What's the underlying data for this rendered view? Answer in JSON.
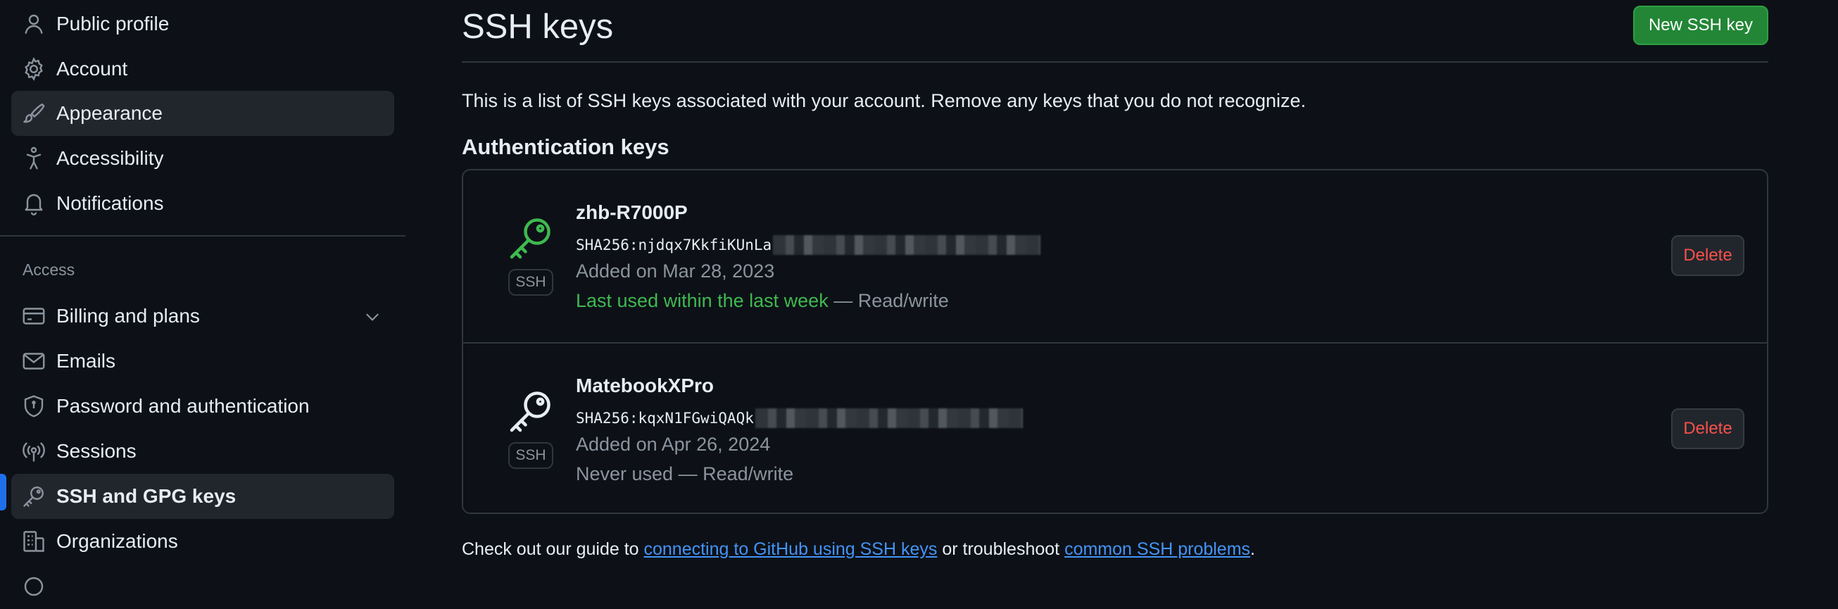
{
  "sidebar": {
    "items_top": [
      {
        "label": "Public profile",
        "icon": "person-icon"
      },
      {
        "label": "Account",
        "icon": "gear-icon"
      },
      {
        "label": "Appearance",
        "icon": "paintbrush-icon"
      },
      {
        "label": "Accessibility",
        "icon": "accessibility-icon"
      },
      {
        "label": "Notifications",
        "icon": "bell-icon"
      }
    ],
    "section_label": "Access",
    "items_access": [
      {
        "label": "Billing and plans",
        "icon": "credit-card-icon"
      },
      {
        "label": "Emails",
        "icon": "mail-icon"
      },
      {
        "label": "Password and authentication",
        "icon": "shield-lock-icon"
      },
      {
        "label": "Sessions",
        "icon": "broadcast-icon"
      },
      {
        "label": "SSH and GPG keys",
        "icon": "key-icon"
      },
      {
        "label": "Organizations",
        "icon": "organization-icon"
      }
    ],
    "active": "SSH and GPG keys",
    "accent": "#1f6feb"
  },
  "main": {
    "title": "SSH keys",
    "new_key_button": "New SSH key",
    "intro": "This is a list of SSH keys associated with your account. Remove any keys that you do not recognize.",
    "section_title": "Authentication keys",
    "keys": [
      {
        "name": "zhb-R7000P",
        "fingerprint": "SHA256:njdqx7KkfiKUnLa",
        "added": "Added on Mar 28, 2023",
        "last_used": "Last used within the last week",
        "access": " — Read/write",
        "badge": "SSH",
        "delete_label": "Delete",
        "icon_color": "#3fb950"
      },
      {
        "name": "MatebookXPro",
        "fingerprint": "SHA256:kqxN1FGwiQAQk",
        "added": "Added on Apr 26, 2024",
        "last_used": "Never used",
        "access": " — Read/write",
        "badge": "SSH",
        "delete_label": "Delete",
        "icon_color": "#e6edf3"
      }
    ],
    "footer": {
      "prefix": "Check out our guide to ",
      "link1": "connecting to GitHub using SSH keys",
      "middle": " or troubleshoot ",
      "link2": "common SSH problems",
      "suffix": "."
    }
  },
  "colors": {
    "background": "#0d1117",
    "primary_button": "#238636",
    "danger": "#f85149",
    "link": "#4493f8",
    "success": "#3fb950"
  }
}
